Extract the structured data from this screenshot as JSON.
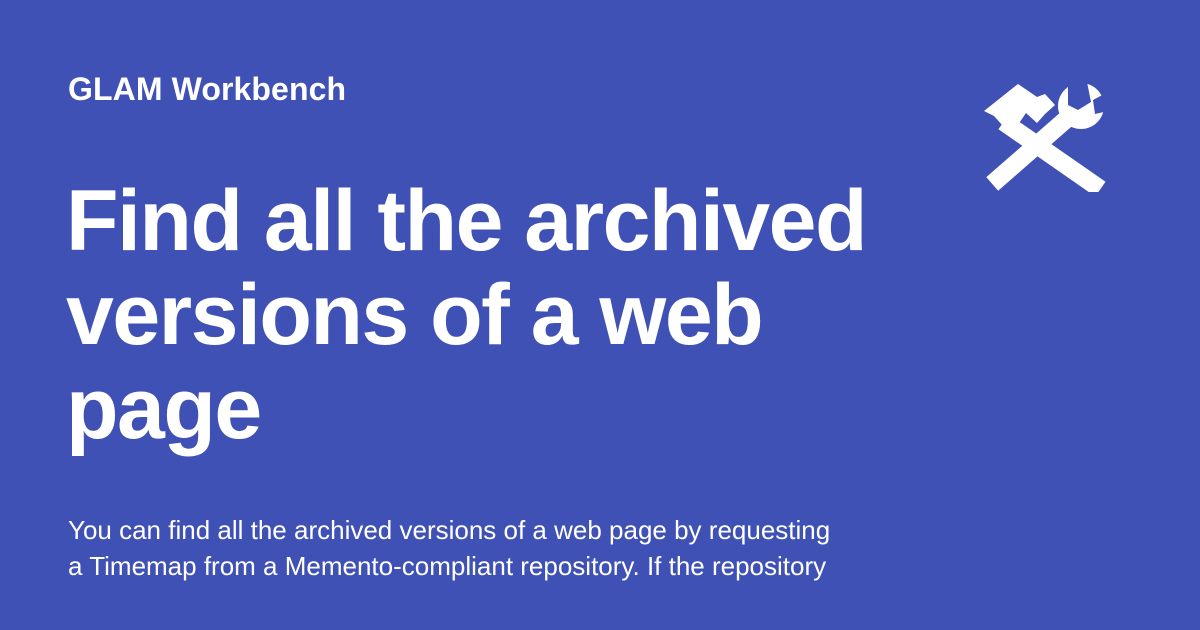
{
  "site": {
    "name": "GLAM Workbench",
    "logo_icon": "hammer-wrench-icon"
  },
  "page": {
    "title": "Find all the archived versions of a web page",
    "description_lines": [
      "You can find all the archived versions of a web page by requesting",
      "a Timemap from a Memento-compliant repository. If the repository"
    ]
  },
  "colors": {
    "background": "#3f51b5",
    "text": "#ffffff"
  }
}
